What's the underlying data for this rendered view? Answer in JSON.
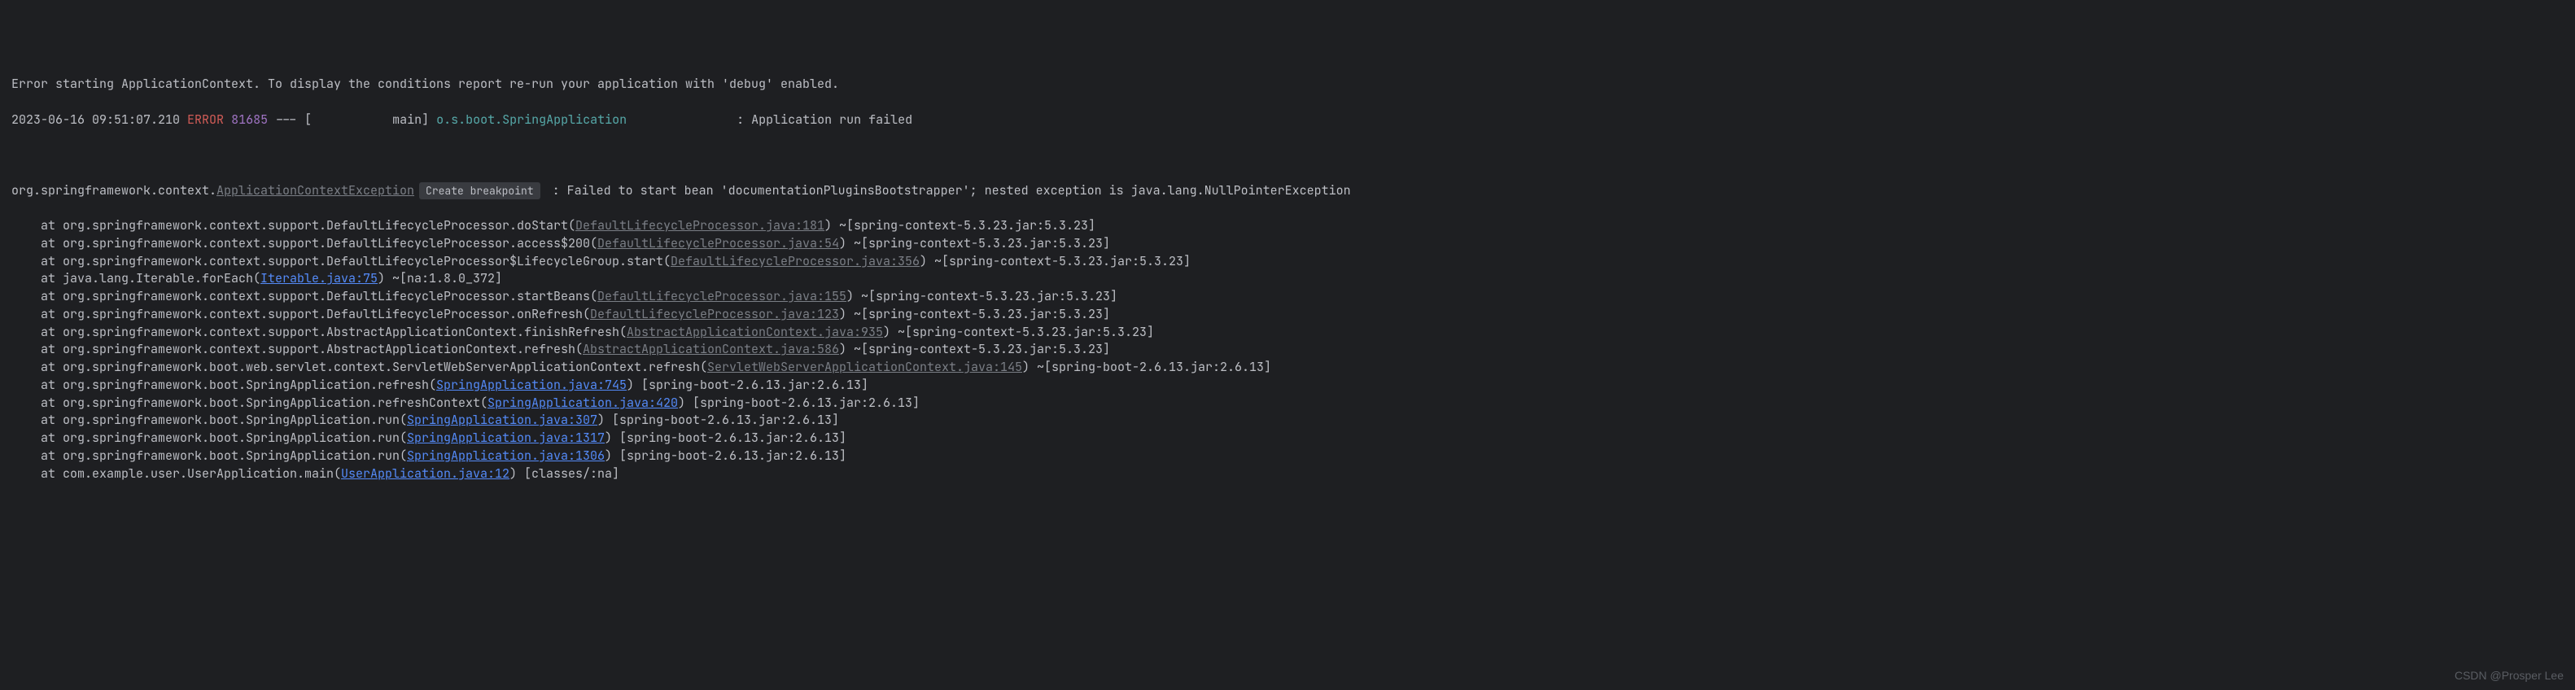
{
  "line1": "Error starting ApplicationContext. To display the conditions report re-run your application with 'debug' enabled.",
  "log": {
    "timestamp": "2023-06-16 09:51:07.210",
    "level": "ERROR",
    "pid": "81685",
    "thread_sep": " --- [           main] ",
    "logger": "o.s.boot.SpringApplication",
    "msg_sep": "               : ",
    "msg": "Application run failed"
  },
  "exc": {
    "pkg": "org.springframework.context.",
    "cls": "ApplicationContextException",
    "btn": "Create breakpoint",
    "msg": " : Failed to start bean 'documentationPluginsBootstrapper'; nested exception is java.lang.NullPointerException"
  },
  "stack": [
    {
      "at": "    at org.springframework.context.support.DefaultLifecycleProcessor.doStart(",
      "link": "DefaultLifecycleProcessor.java:181",
      "suffix": ") ~[spring-context-5.3.23.jar:5.3.23]",
      "lc": "gray"
    },
    {
      "at": "    at org.springframework.context.support.DefaultLifecycleProcessor.access$200(",
      "link": "DefaultLifecycleProcessor.java:54",
      "suffix": ") ~[spring-context-5.3.23.jar:5.3.23]",
      "lc": "gray"
    },
    {
      "at": "    at org.springframework.context.support.DefaultLifecycleProcessor$LifecycleGroup.start(",
      "link": "DefaultLifecycleProcessor.java:356",
      "suffix": ") ~[spring-context-5.3.23.jar:5.3.23]",
      "lc": "gray"
    },
    {
      "at": "    at java.lang.Iterable.forEach(",
      "link": "Iterable.java:75",
      "suffix": ") ~[na:1.8.0_372]",
      "lc": "blue"
    },
    {
      "at": "    at org.springframework.context.support.DefaultLifecycleProcessor.startBeans(",
      "link": "DefaultLifecycleProcessor.java:155",
      "suffix": ") ~[spring-context-5.3.23.jar:5.3.23]",
      "lc": "gray"
    },
    {
      "at": "    at org.springframework.context.support.DefaultLifecycleProcessor.onRefresh(",
      "link": "DefaultLifecycleProcessor.java:123",
      "suffix": ") ~[spring-context-5.3.23.jar:5.3.23]",
      "lc": "gray"
    },
    {
      "at": "    at org.springframework.context.support.AbstractApplicationContext.finishRefresh(",
      "link": "AbstractApplicationContext.java:935",
      "suffix": ") ~[spring-context-5.3.23.jar:5.3.23]",
      "lc": "gray"
    },
    {
      "at": "    at org.springframework.context.support.AbstractApplicationContext.refresh(",
      "link": "AbstractApplicationContext.java:586",
      "suffix": ") ~[spring-context-5.3.23.jar:5.3.23]",
      "lc": "gray"
    },
    {
      "at": "    at org.springframework.boot.web.servlet.context.ServletWebServerApplicationContext.refresh(",
      "link": "ServletWebServerApplicationContext.java:145",
      "suffix": ") ~[spring-boot-2.6.13.jar:2.6.13]",
      "lc": "gray"
    },
    {
      "at": "    at org.springframework.boot.SpringApplication.refresh(",
      "link": "SpringApplication.java:745",
      "suffix": ") [spring-boot-2.6.13.jar:2.6.13]",
      "lc": "blue"
    },
    {
      "at": "    at org.springframework.boot.SpringApplication.refreshContext(",
      "link": "SpringApplication.java:420",
      "suffix": ") [spring-boot-2.6.13.jar:2.6.13]",
      "lc": "blue"
    },
    {
      "at": "    at org.springframework.boot.SpringApplication.run(",
      "link": "SpringApplication.java:307",
      "suffix": ") [spring-boot-2.6.13.jar:2.6.13]",
      "lc": "blue"
    },
    {
      "at": "    at org.springframework.boot.SpringApplication.run(",
      "link": "SpringApplication.java:1317",
      "suffix": ") [spring-boot-2.6.13.jar:2.6.13]",
      "lc": "blue"
    },
    {
      "at": "    at org.springframework.boot.SpringApplication.run(",
      "link": "SpringApplication.java:1306",
      "suffix": ") [spring-boot-2.6.13.jar:2.6.13]",
      "lc": "blue"
    },
    {
      "at": "    at com.example.user.UserApplication.main(",
      "link": "UserApplication.java:12",
      "suffix": ") [classes/:na]",
      "lc": "blue"
    }
  ],
  "watermark": "CSDN @Prosper Lee"
}
